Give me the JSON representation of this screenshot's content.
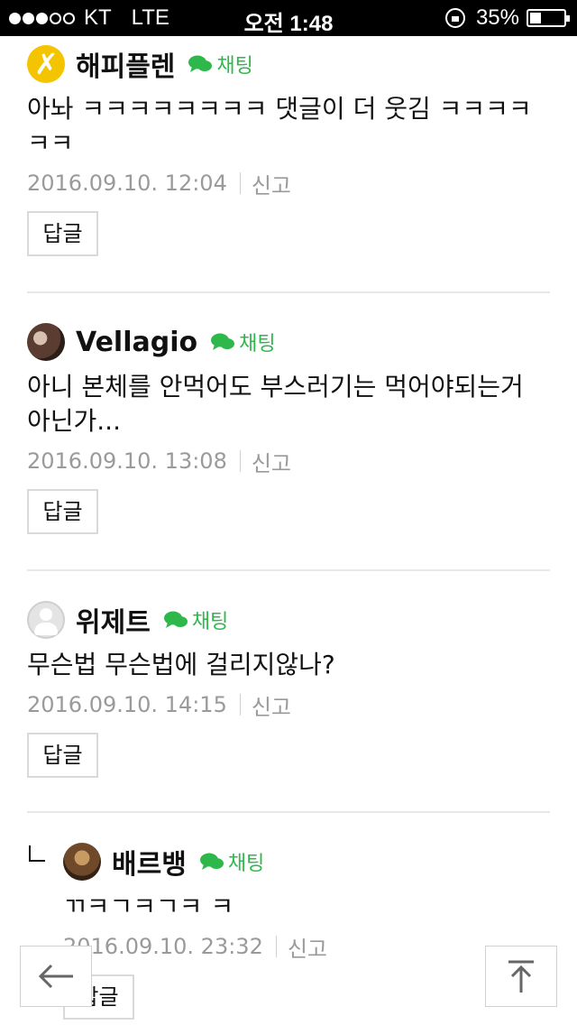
{
  "status_bar": {
    "signal_dots": [
      true,
      true,
      true,
      false,
      false
    ],
    "carrier": "KT",
    "network": "LTE",
    "time": "오전 1:48",
    "battery": "35%",
    "battery_level": 0.35
  },
  "comments": [
    {
      "nickname": "해피플렌",
      "chat_label": "채팅",
      "text": "아놔 ㅋㅋㅋㅋㅋㅋㅋㅋ 댓글이 더 웃김 ㅋㅋㅋㅋㅋㅋ",
      "date": "2016.09.10. 12:04",
      "report_label": "신고",
      "reply_label": "답글"
    },
    {
      "nickname": "Vellagio",
      "chat_label": "채팅",
      "text": "아니 본체를 안먹어도 부스러기는 먹어야되는거 아닌가...",
      "date": "2016.09.10. 13:08",
      "report_label": "신고",
      "reply_label": "답글"
    },
    {
      "nickname": "위제트",
      "chat_label": "채팅",
      "text": "무슨법 무슨법에 걸리지않나?",
      "date": "2016.09.10. 14:15",
      "report_label": "신고",
      "reply_label": "답글"
    },
    {
      "nickname": "배르뱅",
      "chat_label": "채팅",
      "text": "ㄲㅋㄱㅋㄱㅋ ㅋ",
      "date": "2016.09.10. 23:32",
      "report_label": "신고",
      "reply_label": "답글"
    }
  ],
  "colors": {
    "chat_green": "#2eb84b",
    "meta_gray": "#9a9a9a",
    "divider": "#e8e8e8"
  },
  "icons": {
    "back": "arrow-left-icon",
    "top": "scroll-top-icon",
    "chat": "chat-bubble-icon"
  }
}
